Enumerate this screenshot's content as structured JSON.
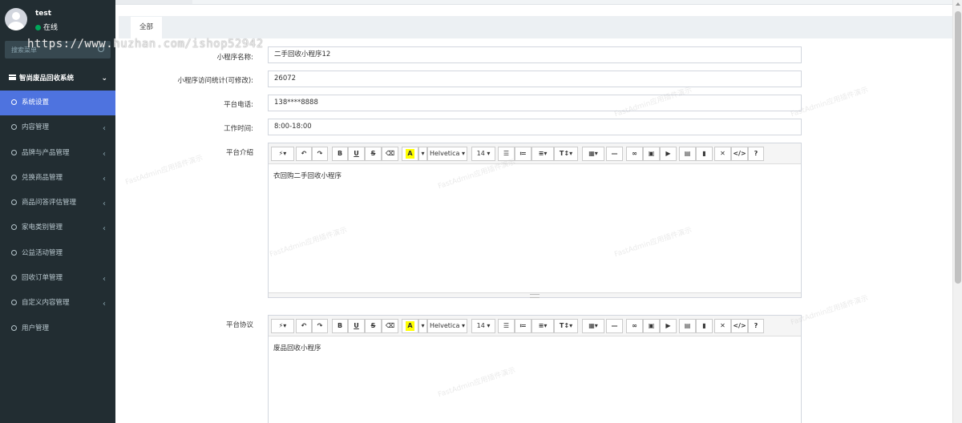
{
  "user": {
    "name": "test",
    "status": "在线"
  },
  "search": {
    "placeholder": "搜索菜单"
  },
  "watermark_url": "https://www.huzhan.com/ishop52942",
  "sidebar": {
    "section_title": "智尚废品回收系统",
    "items": [
      {
        "label": "系统设置",
        "active": true,
        "has_children": false
      },
      {
        "label": "内容管理",
        "has_children": true
      },
      {
        "label": "品牌与产品管理",
        "has_children": true
      },
      {
        "label": "兑换商品管理",
        "has_children": true
      },
      {
        "label": "商品问答评估管理",
        "has_children": true
      },
      {
        "label": "家电类别管理",
        "has_children": true
      },
      {
        "label": "公益活动管理",
        "has_children": false
      },
      {
        "label": "回收订单管理",
        "has_children": true
      },
      {
        "label": "自定义内容管理",
        "has_children": true
      },
      {
        "label": "用户管理",
        "has_children": false
      }
    ]
  },
  "tabs": {
    "all": "全部"
  },
  "form": {
    "name_label": "小程序名称:",
    "name_value": "二手回收小程序12",
    "stats_label": "小程序访问统计(可修改):",
    "stats_value": "26072",
    "phone_label": "平台电话:",
    "phone_value": "138****8888",
    "hours_label": "工作时间:",
    "hours_value": "8:00-18:00",
    "intro_label": "平台介绍",
    "intro_content": "衣回购二手回收小程序",
    "agreement_label": "平台协议",
    "agreement_content": "废品回收小程序"
  },
  "editor_toolbar": {
    "font_name": "Helvetica",
    "font_size": "14"
  },
  "faint_watermark": "FastAdmin应用插件演示",
  "colors": {
    "sidebar_bg": "#222d32",
    "active_item": "#4e73df",
    "status_online": "#00a65a"
  }
}
